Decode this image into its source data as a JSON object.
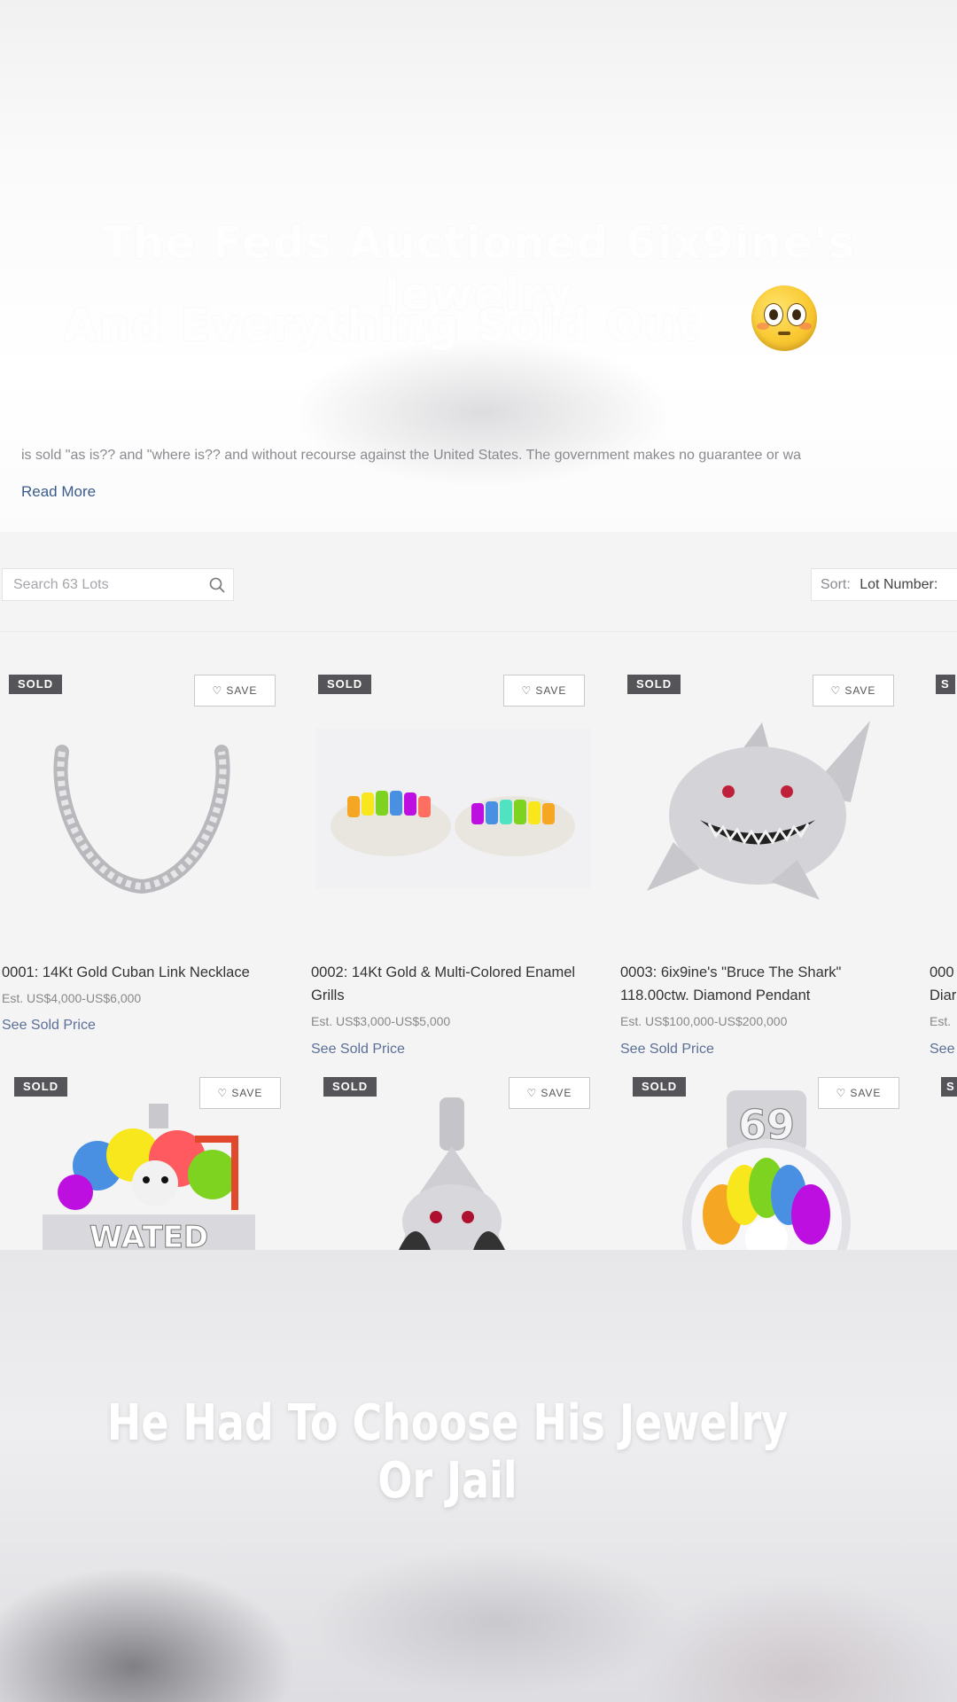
{
  "overlay": {
    "headline_line1": "The Feds Auctioned 6ix9ine's Jewelry",
    "headline_line2": "And Everything Sold Out",
    "caption": "He Had To Choose His Jewelry Or Jail"
  },
  "description": {
    "text": "is sold \"as is?? and \"where is?? and without recourse against the United States. The government makes no guarantee or wa",
    "read_more": "Read More"
  },
  "toolbar": {
    "search_placeholder": "Search 63 Lots",
    "sort_label": "Sort:",
    "sort_value": "Lot Number:"
  },
  "lots": [
    {
      "badge": "SOLD",
      "save": "SAVE",
      "title": "0001: 14Kt Gold Cuban Link Necklace",
      "estimate": "Est. US$4,000-US$6,000",
      "link": "See Sold Price"
    },
    {
      "badge": "SOLD",
      "save": "SAVE",
      "title": "0002: 14Kt Gold & Multi-Colored Enamel Grills",
      "estimate": "Est. US$3,000-US$5,000",
      "link": "See Sold Price"
    },
    {
      "badge": "SOLD",
      "save": "SAVE",
      "title": "0003: 6ix9ine's \"Bruce The Shark\" 118.00ctw. Diamond Pendant",
      "estimate": "Est. US$100,000-US$200,000",
      "link": "See Sold Price"
    },
    {
      "badge": "S",
      "save": "",
      "title": "000",
      "title2": "Diar",
      "estimate": "Est.",
      "link": "See"
    },
    {
      "badge": "SOLD",
      "save": "SAVE",
      "image_text": "WATED"
    },
    {
      "badge": "SOLD",
      "save": "SAVE"
    },
    {
      "badge": "SOLD",
      "save": "SAVE",
      "image_text": "69"
    },
    {
      "badge": "S"
    }
  ]
}
